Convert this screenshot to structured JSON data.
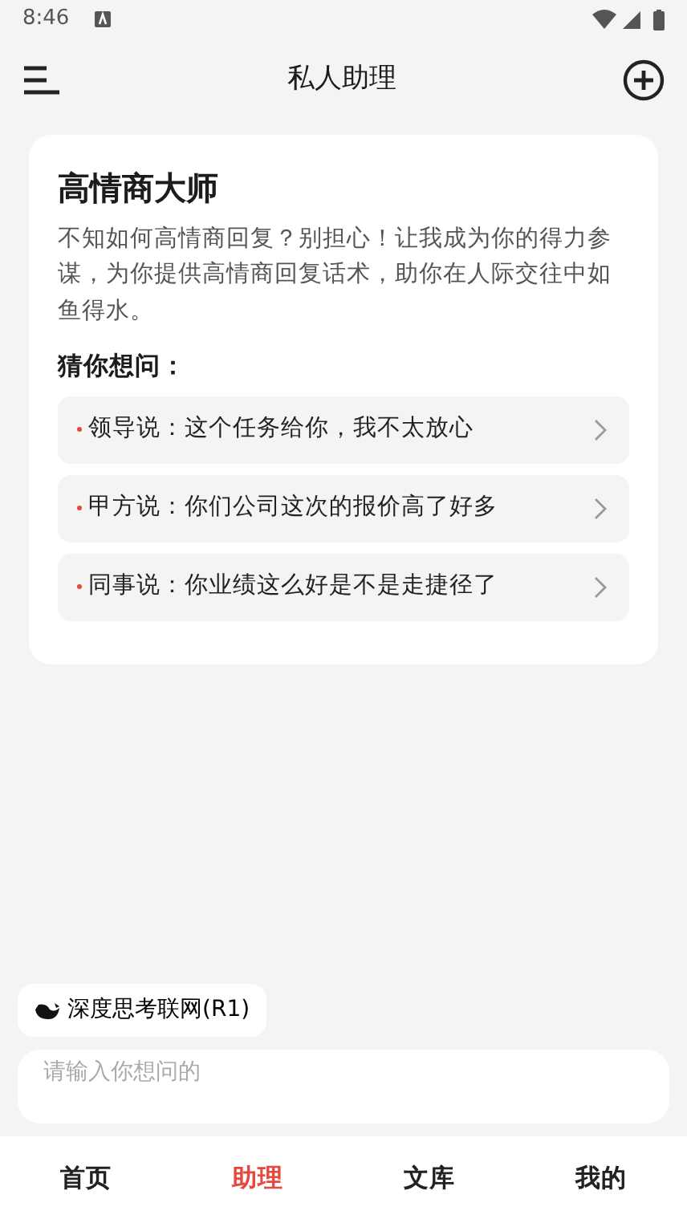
{
  "status_bar": {
    "time": "8:46"
  },
  "header": {
    "title": "私人助理"
  },
  "card": {
    "title": "高情商大师",
    "description": "不知如何高情商回复？别担心！让我成为你的得力参谋，为你提供高情商回复话术，助你在人际交往中如鱼得水。",
    "suggestions_title": "猜你想问：",
    "suggestions": [
      "领导说：这个任务给你，我不太放心",
      "甲方说：你们公司这次的报价高了好多",
      "同事说：你业绩这么好是不是走捷径了"
    ]
  },
  "mode_chip": {
    "label": "深度思考联网(R1)"
  },
  "input": {
    "placeholder": "请输入你想问的"
  },
  "tabs": [
    {
      "label": "首页",
      "selected": false
    },
    {
      "label": "助理",
      "selected": true
    },
    {
      "label": "文库",
      "selected": false
    },
    {
      "label": "我的",
      "selected": false
    }
  ]
}
